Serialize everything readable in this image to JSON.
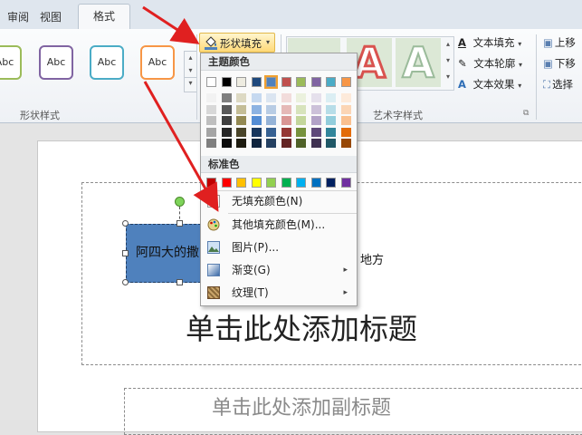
{
  "tabs": [
    {
      "label": "审阅"
    },
    {
      "label": "视图"
    },
    {
      "label": "格式"
    }
  ],
  "shape_styles": {
    "buttons": [
      {
        "label": "Abc",
        "color": "#9bbb59"
      },
      {
        "label": "Abc",
        "color": "#8064a2"
      },
      {
        "label": "Abc",
        "color": "#4bacc6"
      },
      {
        "label": "Abc",
        "color": "#f79646"
      }
    ],
    "group_label": "形状样式"
  },
  "shape_fill": {
    "label": "形状填充",
    "caret": "▾"
  },
  "wordart": {
    "group_label": "艺术字样式",
    "text_fill": "文本填充",
    "text_outline": "文本轮廓",
    "text_effects": "文本效果",
    "letter": "A"
  },
  "arrange": {
    "bring_forward": "上移",
    "send_backward": "下移",
    "selection": "选择"
  },
  "dropdown": {
    "theme_header": "主题颜色",
    "standard_header": "标准色",
    "theme_colors": [
      "#ffffff",
      "#000000",
      "#eeece1",
      "#1f497d",
      "#4f81bd",
      "#c0504d",
      "#9bbb59",
      "#8064a2",
      "#4bacc6",
      "#f79646"
    ],
    "theme_shades": [
      [
        "#f2f2f2",
        "#7f7f7f",
        "#ddd9c3",
        "#c6d9f0",
        "#dbe5f1",
        "#f2dcdb",
        "#ebf1dd",
        "#e5e0ec",
        "#dbeef3",
        "#fdeada"
      ],
      [
        "#d8d8d8",
        "#595959",
        "#c4bd97",
        "#8db3e2",
        "#b8cce4",
        "#e5b9b7",
        "#d7e3bc",
        "#ccc1d9",
        "#b7dde8",
        "#fbd5b5"
      ],
      [
        "#bfbfbf",
        "#3f3f3f",
        "#938953",
        "#548dd4",
        "#95b3d7",
        "#d99694",
        "#c3d69b",
        "#b2a2c7",
        "#92cddc",
        "#fac08f"
      ],
      [
        "#a5a5a5",
        "#262626",
        "#494429",
        "#17365d",
        "#366092",
        "#953734",
        "#76923c",
        "#5f497a",
        "#31859b",
        "#e36c09"
      ],
      [
        "#7f7f7f",
        "#0c0c0c",
        "#1d1b10",
        "#0f243e",
        "#244061",
        "#632423",
        "#4f6128",
        "#3f3151",
        "#205867",
        "#974806"
      ]
    ],
    "standard_colors": [
      "#c00000",
      "#ff0000",
      "#ffc000",
      "#ffff00",
      "#92d050",
      "#00b050",
      "#00b0f0",
      "#0070c0",
      "#002060",
      "#7030a0"
    ],
    "items": [
      {
        "label": "无填充颜色(N)",
        "icon": "no-fill-icon",
        "arrow": ""
      },
      {
        "label": "其他填充颜色(M)...",
        "icon": "palette-icon",
        "arrow": ""
      },
      {
        "label": "图片(P)...",
        "icon": "picture-icon",
        "arrow": ""
      },
      {
        "label": "渐变(G)",
        "icon": "gradient-icon",
        "arrow": "▸"
      },
      {
        "label": "纹理(T)",
        "icon": "texture-icon",
        "arrow": "▸"
      }
    ]
  },
  "slide": {
    "shape_text": "阿四大的撒",
    "shape_text_tail": "地方",
    "title_placeholder": "单击此处添加标题",
    "subtitle_placeholder": "单击此处添加副标题"
  },
  "colors": {
    "accent_shape": "#4f81bd",
    "annotation_arrow": "#e02020"
  }
}
